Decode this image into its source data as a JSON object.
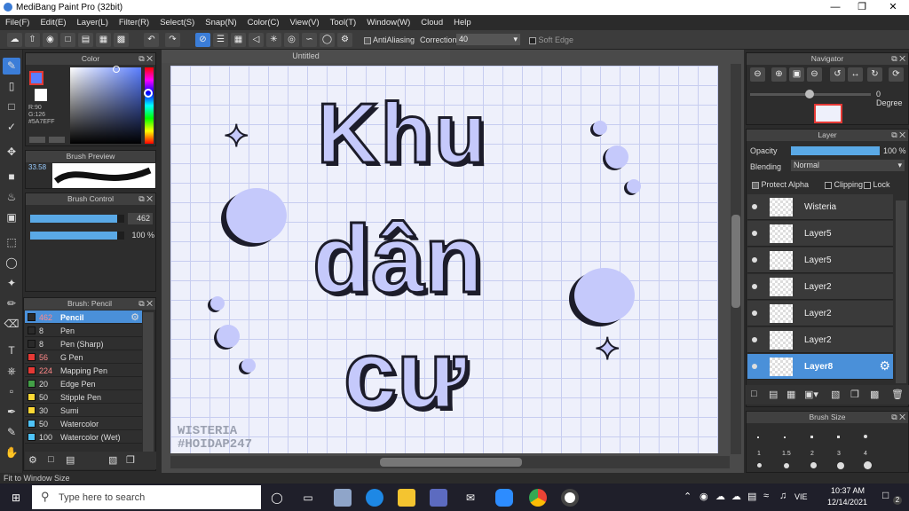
{
  "window": {
    "title": "MediBang Paint Pro (32bit)"
  },
  "menu": [
    "File(F)",
    "Edit(E)",
    "Layer(L)",
    "Filter(R)",
    "Select(S)",
    "Snap(N)",
    "Color(C)",
    "View(V)",
    "Tool(T)",
    "Window(W)",
    "Cloud",
    "Help"
  ],
  "toolbar": {
    "antialiasing": "AntiAliasing",
    "correction_label": "Correction",
    "correction_value": "40",
    "soft_edge": "Soft Edge"
  },
  "canvas_tab": "Untitled",
  "color_panel": {
    "title": "Color",
    "r": "R:90",
    "g": "G:126",
    "hex": "#5A7EFF"
  },
  "brush_preview": {
    "title": "Brush Preview",
    "size": "33.58"
  },
  "brush_control": {
    "title": "Brush Control",
    "size": "462",
    "opacity": "100 %",
    "size_fill": 0.92,
    "opacity_fill": 0.92
  },
  "brush_list": {
    "title": "Brush: Pencil",
    "items": [
      {
        "size": "462",
        "name": "Pencil",
        "color": "#2a2a2a"
      },
      {
        "size": "8",
        "name": "Pen",
        "color": "#2a2a2a"
      },
      {
        "size": "8",
        "name": "Pen (Sharp)",
        "color": "#2a2a2a"
      },
      {
        "size": "56",
        "name": "G Pen",
        "color": "#e53935"
      },
      {
        "size": "224",
        "name": "Mapping Pen",
        "color": "#e53935"
      },
      {
        "size": "20",
        "name": "Edge Pen",
        "color": "#43a047"
      },
      {
        "size": "50",
        "name": "Stipple Pen",
        "color": "#fdd835"
      },
      {
        "size": "30",
        "name": "Sumi",
        "color": "#fdd835"
      },
      {
        "size": "50",
        "name": "Watercolor",
        "color": "#4fc3f7"
      },
      {
        "size": "100",
        "name": "Watercolor (Wet)",
        "color": "#4fc3f7"
      }
    ]
  },
  "artwork": {
    "line1": "Khu",
    "line2": "dân",
    "line3": "cư",
    "watermark1": "WISTERIA",
    "watermark2": "#HOIDAP247"
  },
  "navigator": {
    "title": "Navigator",
    "rotation": "0 Degree"
  },
  "layer_panel": {
    "title": "Layer",
    "opacity_label": "Opacity",
    "opacity_value": "100 %",
    "blending_label": "Blending",
    "blending_value": "Normal",
    "protect_alpha": "Protect Alpha",
    "clipping": "Clipping",
    "lock": "Lock",
    "layers": [
      "Wisteria",
      "Layer5",
      "Layer5",
      "Layer2",
      "Layer2",
      "Layer2",
      "Layer8"
    ]
  },
  "brush_size": {
    "title": "Brush Size",
    "sizes": [
      "1",
      "1.5",
      "2",
      "3",
      "4"
    ]
  },
  "status": "Fit to Window Size",
  "taskbar": {
    "search_placeholder": "Type here to search",
    "time": "10:37 AM",
    "date": "12/14/2021",
    "lang": "VIE",
    "notif": "2"
  }
}
